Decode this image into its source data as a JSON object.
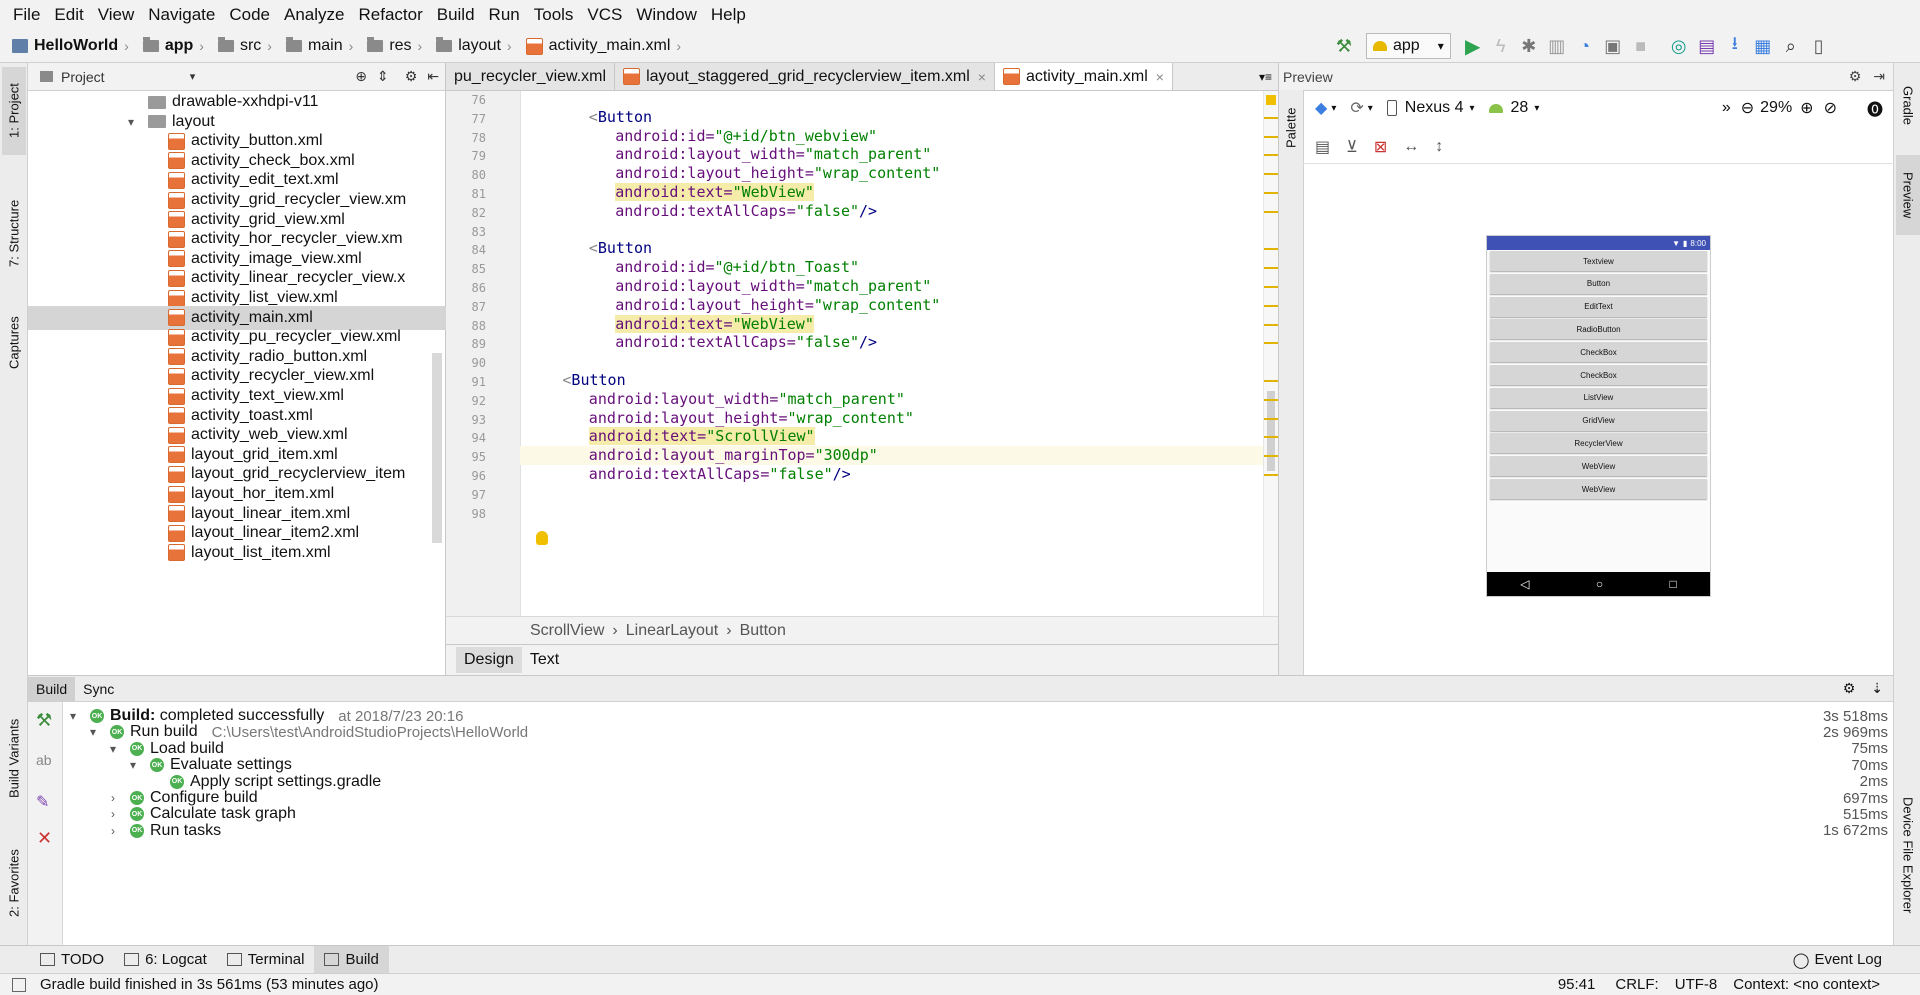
{
  "menu": [
    "File",
    "Edit",
    "View",
    "Navigate",
    "Code",
    "Analyze",
    "Refactor",
    "Build",
    "Run",
    "Tools",
    "VCS",
    "Window",
    "Help"
  ],
  "nav": {
    "project": "HelloWorld",
    "items": [
      "app",
      "src",
      "main",
      "res",
      "layout",
      "activity_main.xml"
    ]
  },
  "run_config": "app",
  "side_left": {
    "project": "1: Project",
    "structure": "7: Structure",
    "captures": "Captures",
    "build_variants": "Build Variants",
    "favorites": "2: Favorites"
  },
  "side_right": {
    "gradle": "Gradle",
    "preview": "Preview",
    "device_explorer": "Device File Explorer"
  },
  "project_panel": {
    "title": "Project",
    "items": [
      {
        "label": "drawable-xxhdpi-v11",
        "type": "folder",
        "indent": 1
      },
      {
        "label": "layout",
        "type": "folder-open",
        "indent": 1
      },
      {
        "label": "activity_button.xml",
        "type": "xml",
        "indent": 2
      },
      {
        "label": "activity_check_box.xml",
        "type": "xml",
        "indent": 2
      },
      {
        "label": "activity_edit_text.xml",
        "type": "xml",
        "indent": 2
      },
      {
        "label": "activity_grid_recycler_view.xm",
        "type": "xml",
        "indent": 2
      },
      {
        "label": "activity_grid_view.xml",
        "type": "xml",
        "indent": 2
      },
      {
        "label": "activity_hor_recycler_view.xm",
        "type": "xml",
        "indent": 2
      },
      {
        "label": "activity_image_view.xml",
        "type": "xml",
        "indent": 2
      },
      {
        "label": "activity_linear_recycler_view.x",
        "type": "xml",
        "indent": 2
      },
      {
        "label": "activity_list_view.xml",
        "type": "xml",
        "indent": 2
      },
      {
        "label": "activity_main.xml",
        "type": "xml",
        "indent": 2,
        "selected": true
      },
      {
        "label": "activity_pu_recycler_view.xml",
        "type": "xml",
        "indent": 2
      },
      {
        "label": "activity_radio_button.xml",
        "type": "xml",
        "indent": 2
      },
      {
        "label": "activity_recycler_view.xml",
        "type": "xml",
        "indent": 2
      },
      {
        "label": "activity_text_view.xml",
        "type": "xml",
        "indent": 2
      },
      {
        "label": "activity_toast.xml",
        "type": "xml",
        "indent": 2
      },
      {
        "label": "activity_web_view.xml",
        "type": "xml",
        "indent": 2
      },
      {
        "label": "layout_grid_item.xml",
        "type": "xml",
        "indent": 2
      },
      {
        "label": "layout_grid_recyclerview_item",
        "type": "xml",
        "indent": 2
      },
      {
        "label": "layout_hor_item.xml",
        "type": "xml",
        "indent": 2
      },
      {
        "label": "layout_linear_item.xml",
        "type": "xml",
        "indent": 2
      },
      {
        "label": "layout_linear_item2.xml",
        "type": "xml",
        "indent": 2
      },
      {
        "label": "layout_list_item.xml",
        "type": "xml",
        "indent": 2
      }
    ]
  },
  "editor_tabs": [
    "pu_recycler_view.xml",
    "layout_staggered_grid_recyclerview_item.xml",
    "activity_main.xml"
  ],
  "code_lines": [
    {
      "n": "76",
      "parts": []
    },
    {
      "n": "77",
      "indent": 8,
      "parts": [
        {
          "t": "<",
          "c": "tag"
        },
        {
          "t": "Button",
          "c": "tag"
        }
      ]
    },
    {
      "n": "78",
      "indent": 12,
      "parts": [
        {
          "t": "android:id=",
          "c": "attr"
        },
        {
          "t": "\"@+id/btn_webview\"",
          "c": "val"
        }
      ]
    },
    {
      "n": "79",
      "indent": 12,
      "parts": [
        {
          "t": "android:layout_width=",
          "c": "attr"
        },
        {
          "t": "\"match_parent\"",
          "c": "val"
        }
      ]
    },
    {
      "n": "80",
      "indent": 12,
      "parts": [
        {
          "t": "android:layout_height=",
          "c": "attr"
        },
        {
          "t": "\"wrap_content\"",
          "c": "val"
        }
      ]
    },
    {
      "n": "81",
      "indent": 12,
      "hl": true,
      "parts": [
        {
          "t": "android:text=",
          "c": "attr"
        },
        {
          "t": "\"WebView\"",
          "c": "val"
        }
      ]
    },
    {
      "n": "82",
      "indent": 12,
      "parts": [
        {
          "t": "android:textAllCaps=",
          "c": "attr"
        },
        {
          "t": "\"false\"",
          "c": "val"
        },
        {
          "t": "/>",
          "c": "tag"
        }
      ]
    },
    {
      "n": "83",
      "parts": []
    },
    {
      "n": "84",
      "indent": 8,
      "parts": [
        {
          "t": "<",
          "c": "tag"
        },
        {
          "t": "Button",
          "c": "tag"
        }
      ]
    },
    {
      "n": "85",
      "indent": 12,
      "parts": [
        {
          "t": "android:id=",
          "c": "attr"
        },
        {
          "t": "\"@+id/btn_Toast\"",
          "c": "val"
        }
      ]
    },
    {
      "n": "86",
      "indent": 12,
      "parts": [
        {
          "t": "android:layout_width=",
          "c": "attr"
        },
        {
          "t": "\"match_parent\"",
          "c": "val"
        }
      ]
    },
    {
      "n": "87",
      "indent": 12,
      "parts": [
        {
          "t": "android:layout_height=",
          "c": "attr"
        },
        {
          "t": "\"wrap_content\"",
          "c": "val"
        }
      ]
    },
    {
      "n": "88",
      "indent": 12,
      "hl": true,
      "parts": [
        {
          "t": "android:text=",
          "c": "attr"
        },
        {
          "t": "\"WebView\"",
          "c": "val"
        }
      ]
    },
    {
      "n": "89",
      "indent": 12,
      "parts": [
        {
          "t": "android:textAllCaps=",
          "c": "attr"
        },
        {
          "t": "\"false\"",
          "c": "val"
        },
        {
          "t": "/>",
          "c": "tag"
        }
      ]
    },
    {
      "n": "90",
      "parts": []
    },
    {
      "n": "91",
      "indent": 4,
      "parts": [
        {
          "t": "<",
          "c": "tag"
        },
        {
          "t": "Button",
          "c": "tag"
        }
      ]
    },
    {
      "n": "92",
      "indent": 8,
      "parts": [
        {
          "t": "android:layout_width=",
          "c": "attr"
        },
        {
          "t": "\"match_parent\"",
          "c": "val"
        }
      ]
    },
    {
      "n": "93",
      "indent": 8,
      "parts": [
        {
          "t": "android:layout_height=",
          "c": "attr"
        },
        {
          "t": "\"wrap_content\"",
          "c": "val"
        }
      ]
    },
    {
      "n": "94",
      "indent": 8,
      "hl": true,
      "parts": [
        {
          "t": "android:text=",
          "c": "attr"
        },
        {
          "t": "\"ScrollView\"",
          "c": "val"
        }
      ]
    },
    {
      "n": "95",
      "indent": 8,
      "current": true,
      "parts": [
        {
          "t": "android:layout_marginTop=",
          "c": "attr"
        },
        {
          "t": "\"300dp\"",
          "c": "val"
        }
      ]
    },
    {
      "n": "96",
      "indent": 8,
      "parts": [
        {
          "t": "android:textAllCaps=",
          "c": "attr"
        },
        {
          "t": "\"false\"",
          "c": "val"
        },
        {
          "t": "/>",
          "c": "tag"
        }
      ]
    },
    {
      "n": "97",
      "parts": []
    },
    {
      "n": "98",
      "parts": []
    }
  ],
  "editor_breadcrumb": [
    "ScrollView",
    "LinearLayout",
    "Button"
  ],
  "design_tabs": [
    "Design",
    "Text"
  ],
  "preview": {
    "title": "Preview",
    "device": "Nexus 4",
    "api": "28",
    "zoom": "29%",
    "time": "8:00",
    "buttons": [
      "Textview",
      "Button",
      "EditText",
      "RadioButton",
      "CheckBox",
      "CheckBox",
      "ListView",
      "GridView",
      "RecyclerView",
      "WebView",
      "WebView"
    ],
    "palette": "Palette"
  },
  "build_tabs": [
    "Build",
    "Sync"
  ],
  "build_rows": [
    {
      "level": 0,
      "arrow": "▾",
      "bold": "Build:",
      "text": " completed successfully",
      "extra": "at 2018/7/23 20:16",
      "dur": "3s 518ms"
    },
    {
      "level": 1,
      "arrow": "▾",
      "text": "Run build",
      "extra": "C:\\Users\\test\\AndroidStudioProjects\\HelloWorld",
      "dur": "2s 969ms"
    },
    {
      "level": 2,
      "arrow": "▾",
      "text": "Load build",
      "dur": "75ms"
    },
    {
      "level": 3,
      "arrow": "▾",
      "text": "Evaluate settings",
      "dur": "70ms"
    },
    {
      "level": 4,
      "arrow": "",
      "text": "Apply script settings.gradle",
      "dur": "2ms"
    },
    {
      "level": 2,
      "arrow": "›",
      "text": "Configure build",
      "dur": "697ms"
    },
    {
      "level": 2,
      "arrow": "›",
      "text": "Calculate task graph",
      "dur": "515ms"
    },
    {
      "level": 2,
      "arrow": "›",
      "text": "Run tasks",
      "dur": "1s 672ms"
    }
  ],
  "ok_label": "OK",
  "tool_tabs": [
    {
      "label": "TODO",
      "icon": "todo-icon"
    },
    {
      "label": "6: Logcat",
      "icon": "logcat-icon"
    },
    {
      "label": "Terminal",
      "icon": "terminal-icon"
    },
    {
      "label": "Build",
      "icon": "build-icon",
      "active": true
    }
  ],
  "event_log": "Event Log",
  "status": {
    "message": "Gradle build finished in 3s 561ms (53 minutes ago)",
    "position": "95:41",
    "line_sep": "CRLF:",
    "encoding": "UTF-8",
    "context": "Context: <no context>"
  },
  "colors": {
    "accent": "#3d7fe0",
    "ok": "#4caf50",
    "xml": "#e8733a",
    "highlight": "#f6ecaa"
  }
}
